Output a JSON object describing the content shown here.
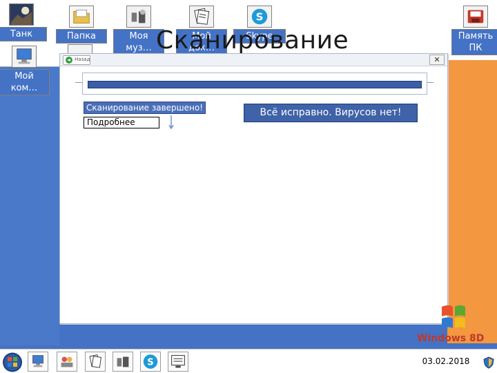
{
  "heading": "Сканирование",
  "desktop_icons": [
    {
      "label": "Танк"
    },
    {
      "label": "Папка"
    },
    {
      "label": "Моя муз…"
    },
    {
      "label": "Мой док…"
    },
    {
      "label": "Skype"
    },
    {
      "label": "Память ПК"
    },
    {
      "label": "Мой ком…"
    }
  ],
  "window": {
    "back_label": "Назад",
    "close_glyph": "✕"
  },
  "scan": {
    "progress_percent": 100,
    "status": "Сканирование завершено!",
    "details_label": "Подробнее",
    "result": "Всё исправно. Вирусов нет!"
  },
  "brand": {
    "logo_text": "Windows 8D"
  },
  "taskbar": {
    "clock": "03.02.2018"
  },
  "colors": {
    "desktop_blue": "#4472c4",
    "accent_orange": "#f39740",
    "progress_blue": "#3b5ea8"
  },
  "icons": [
    "tank-icon",
    "folder-icon",
    "music-icon",
    "documents-icon",
    "skype-icon",
    "memory-icon",
    "computer-icon"
  ]
}
